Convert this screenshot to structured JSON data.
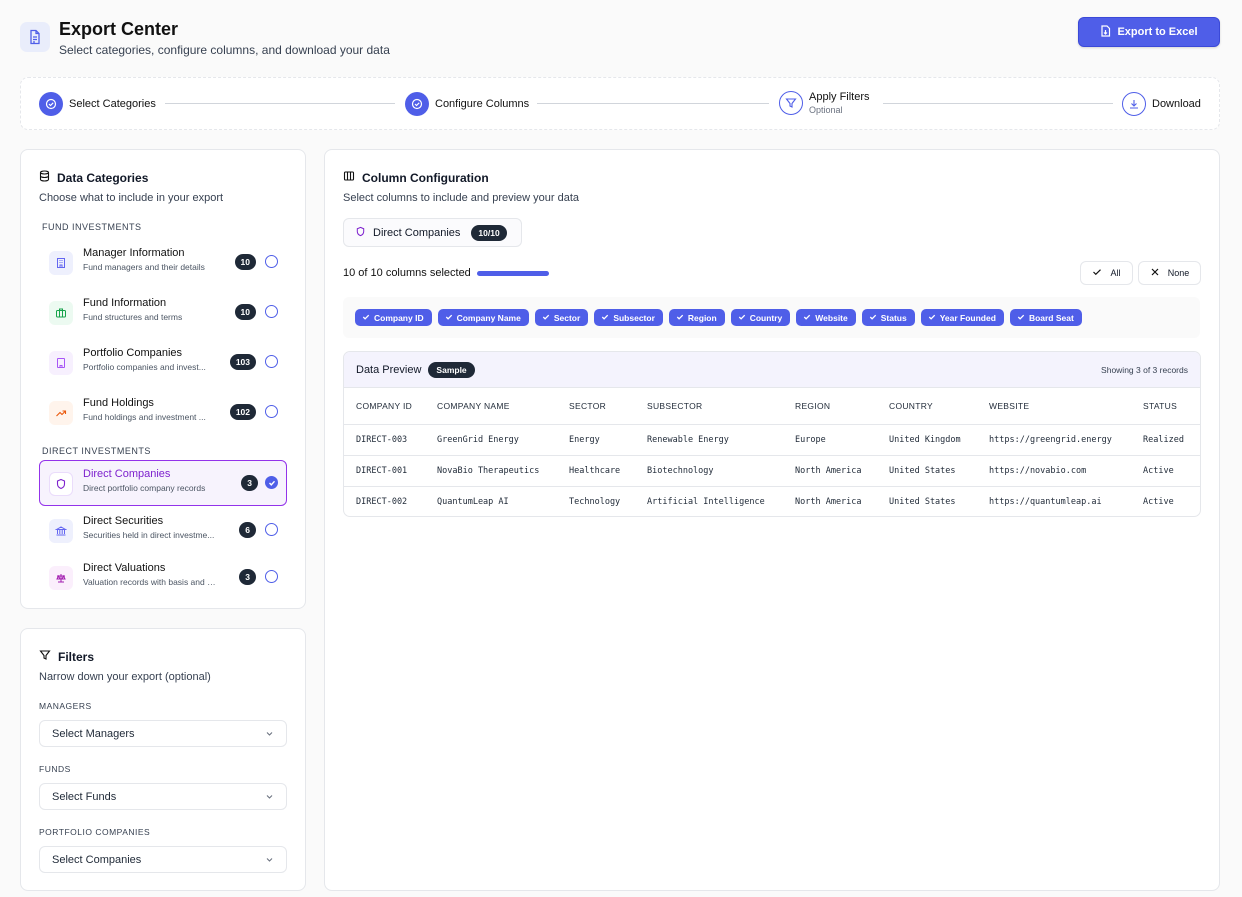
{
  "header": {
    "title": "Export Center",
    "subtitle": "Select categories, configure columns, and download your data",
    "export_label": "Export to Excel"
  },
  "stepper": {
    "steps": [
      {
        "label": "Select Categories",
        "sublabel": "",
        "state": "done"
      },
      {
        "label": "Configure Columns",
        "sublabel": "",
        "state": "done"
      },
      {
        "label": "Apply Filters",
        "sublabel": "Optional",
        "state": "todo"
      },
      {
        "label": "Download",
        "sublabel": "",
        "state": "todo"
      }
    ]
  },
  "categories": {
    "title": "Data Categories",
    "description": "Choose what to include in your export",
    "section_fund": "FUND INVESTMENTS",
    "section_direct": "DIRECT INVESTMENTS",
    "items": [
      {
        "name": "Manager Information",
        "desc": "Fund managers and their details",
        "count": "10",
        "icon": "building-icon",
        "color": "#6366f1",
        "selected": false
      },
      {
        "name": "Fund Information",
        "desc": "Fund structures and terms",
        "count": "10",
        "icon": "briefcase-icon",
        "color": "#16a34a",
        "selected": false
      },
      {
        "name": "Portfolio Companies",
        "desc": "Portfolio companies and invest...",
        "count": "103",
        "icon": "office-icon",
        "color": "#a855f7",
        "selected": false
      },
      {
        "name": "Fund Holdings",
        "desc": "Fund holdings and investment ...",
        "count": "102",
        "icon": "trending-up-icon",
        "color": "#ea580c",
        "selected": false
      },
      {
        "name": "Direct Companies",
        "desc": "Direct portfolio company records",
        "count": "3",
        "icon": "shield-icon",
        "color": "#7e22ce",
        "selected": true
      },
      {
        "name": "Direct Securities",
        "desc": "Securities held in direct investme...",
        "count": "6",
        "icon": "bank-icon",
        "color": "#6366f1",
        "selected": false
      },
      {
        "name": "Direct Valuations",
        "desc": "Valuation records with basis and s...",
        "count": "3",
        "icon": "scale-icon",
        "color": "#a21caf",
        "selected": false
      }
    ]
  },
  "filters": {
    "title": "Filters",
    "description": "Narrow down your export (optional)",
    "managers_label": "MANAGERS",
    "managers_value": "Select Managers",
    "funds_label": "FUNDS",
    "funds_value": "Select Funds",
    "companies_label": "PORTFOLIO COMPANIES",
    "companies_value": "Select Companies"
  },
  "columns": {
    "title": "Column Configuration",
    "description": "Select columns to include and preview your data",
    "tab_label": "Direct Companies",
    "tab_count": "10/10",
    "selected_text": "10 of 10 columns selected",
    "selected_fraction": 1.0,
    "all_label": "All",
    "none_label": "None",
    "chips": [
      "Company ID",
      "Company Name",
      "Sector",
      "Subsector",
      "Region",
      "Country",
      "Website",
      "Status",
      "Year Founded",
      "Board Seat"
    ]
  },
  "preview": {
    "title": "Data Preview",
    "badge": "Sample",
    "showing": "Showing 3 of 3 records",
    "headers": [
      "COMPANY ID",
      "COMPANY NAME",
      "SECTOR",
      "SUBSECTOR",
      "REGION",
      "COUNTRY",
      "WEBSITE",
      "STATUS"
    ],
    "rows": [
      [
        "DIRECT-003",
        "GreenGrid Energy",
        "Energy",
        "Renewable Energy",
        "Europe",
        "United Kingdom",
        "https://greengrid.energy",
        "Realized"
      ],
      [
        "DIRECT-001",
        "NovaBio Therapeutics",
        "Healthcare",
        "Biotechnology",
        "North America",
        "United States",
        "https://novabio.com",
        "Active"
      ],
      [
        "DIRECT-002",
        "QuantumLeap AI",
        "Technology",
        "Artificial Intelligence",
        "North America",
        "United States",
        "https://quantumleap.ai",
        "Active"
      ]
    ]
  },
  "colors": {
    "accent": "#4f5ee8",
    "selected_border": "#9333ea",
    "badge_bg": "#1f2937"
  }
}
